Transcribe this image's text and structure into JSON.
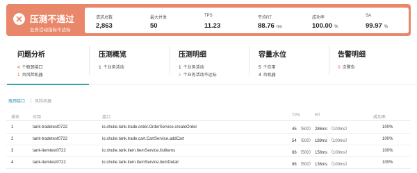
{
  "banner": {
    "title": "压测不通过",
    "subtitle": "业务活动指标不达标",
    "status_icon": "close-icon",
    "bg_color": "#e8876a",
    "stats": [
      {
        "label": "请求总数",
        "value": "2,863",
        "unit": ""
      },
      {
        "label": "最大并发",
        "value": "50",
        "unit": ""
      },
      {
        "label": "TPS",
        "value": "11.23",
        "unit": ""
      },
      {
        "label": "平均RT",
        "value": "88.76",
        "unit": "ms"
      },
      {
        "label": "成功率",
        "value": "100.00",
        "unit": "%"
      },
      {
        "label": "SA",
        "value": "99.97",
        "unit": "%"
      }
    ]
  },
  "summary": {
    "accent_color": "#39a1a8",
    "panels": [
      {
        "title": "问题分析",
        "lines": [
          {
            "num": "4",
            "text": "个瓶颈接口",
            "color": "red"
          },
          {
            "num": "1",
            "text": "台风险机器",
            "color": "red"
          }
        ]
      },
      {
        "title": "压测概览",
        "lines": [
          {
            "num": "1",
            "text": "个业务活动",
            "color": "dark"
          }
        ]
      },
      {
        "title": "压测明细",
        "lines": [
          {
            "num": "1",
            "text": "个业务活动",
            "color": "dark"
          },
          {
            "num": "1",
            "text": "个业务活动不达标",
            "color": "orange"
          }
        ]
      },
      {
        "title": "容量水位",
        "lines": [
          {
            "num": "5",
            "text": "个应用",
            "color": "dark"
          },
          {
            "num": "4",
            "text": "台机器",
            "color": "dark"
          }
        ]
      },
      {
        "title": "告警明细",
        "lines": [
          {
            "num": "0",
            "text": "次警告",
            "color": "red"
          }
        ]
      }
    ]
  },
  "tabs": [
    {
      "label": "瓶颈接口",
      "active": true
    },
    {
      "label": "风险机器",
      "active": false
    }
  ],
  "table": {
    "headers": [
      "排名",
      "应用",
      "接口",
      "TPS",
      "RT",
      "成功率"
    ],
    "rows": [
      {
        "rank": "1",
        "app": "tank-tradetest0722",
        "api": "io.shulie.tank.trade.order.OrderService.createOrder",
        "tps": "45",
        "tps_target": "（500）",
        "rt": "286ms",
        "rt_target": "（100ms）",
        "success": "100%"
      },
      {
        "rank": "2",
        "app": "tank-tradetest0722",
        "api": "io.shulie.tank.trade.cart.CartService.addCart",
        "tps": "54",
        "tps_target": "（500）",
        "rt": "189ms",
        "rt_target": "（100ms）",
        "success": "100%"
      },
      {
        "rank": "3",
        "app": "tank-itemtest0722",
        "api": "io.shulie.tank.item.ItemService.listItems",
        "tps": "86",
        "tps_target": "（500）",
        "rt": "158ms",
        "rt_target": "（100ms）",
        "success": "100%"
      },
      {
        "rank": "4",
        "app": "tank-itemtest0722",
        "api": "io.shulie.tank.item.ItemService.itemDetail",
        "tps": "98",
        "tps_target": "（500）",
        "rt": "136ms",
        "rt_target": "（100ms）",
        "success": "100%"
      }
    ]
  }
}
